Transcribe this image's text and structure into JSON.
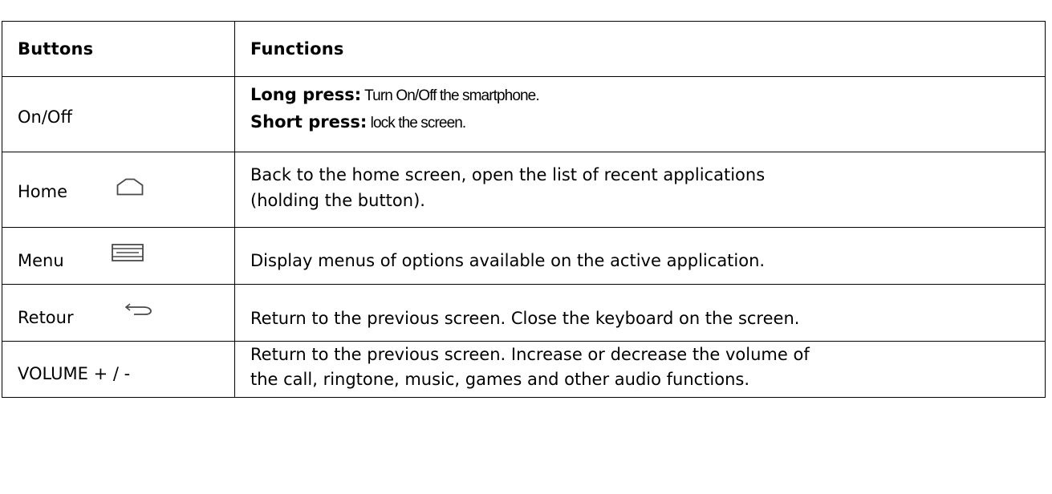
{
  "table": {
    "headers": {
      "buttons": "Buttons",
      "functions": "Functions"
    },
    "rows": {
      "onoff": {
        "button": "On/Off",
        "long_press_label": "Long press:",
        "long_press_text": " Turn On/Off the smartphone.",
        "short_press_label": "Short press:",
        "short_press_text": " lock the screen."
      },
      "home": {
        "button": "Home",
        "icon": "home-icon",
        "function_line1": "Back to the home screen, open the list of recent applications",
        "function_line2": "(holding the button)."
      },
      "menu": {
        "button": "Menu",
        "icon": "menu-icon",
        "function": "Display menus of options available on the active application."
      },
      "retour": {
        "button": "Retour",
        "icon": "back-arrow-icon",
        "function": "Return to the previous screen. Close the keyboard on the screen."
      },
      "volume": {
        "button": "VOLUME + / -",
        "function_line1": "Return to the previous screen. Increase or decrease the volume of",
        "function_line2": "the call, ringtone, music, games and other audio functions."
      }
    }
  },
  "colors": {
    "border": "#000000",
    "icon": "#4a4a4a",
    "text": "#000000",
    "background": "#ffffff"
  }
}
